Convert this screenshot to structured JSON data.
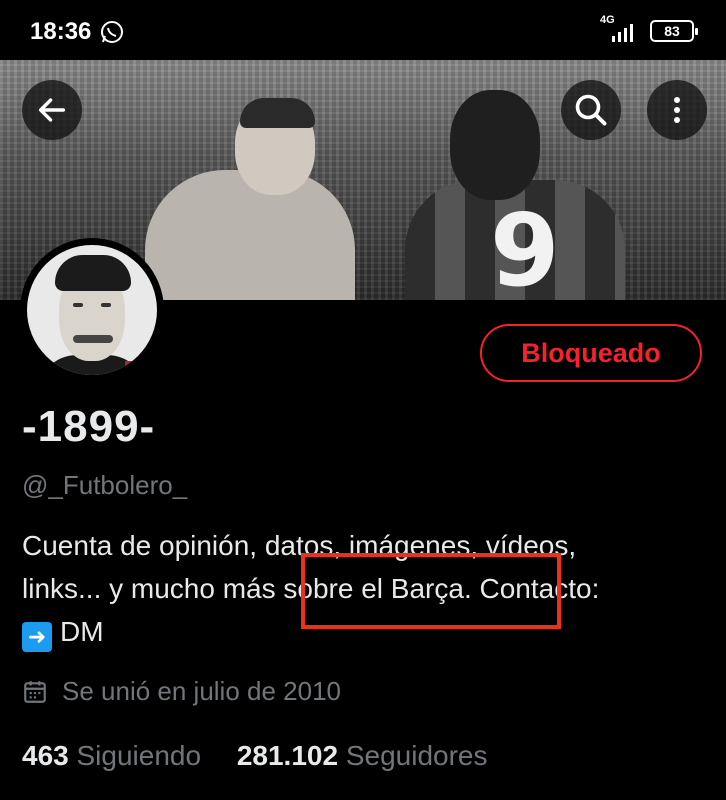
{
  "status_bar": {
    "time": "18:36",
    "network": "4G",
    "battery": "83"
  },
  "profile": {
    "display_name": "-1899-",
    "handle": "@_Futbolero_",
    "blocked_label": "Bloqueado",
    "bio_line1": "Cuenta de opinión, datos, imágenes, vídeos,",
    "bio_line2": "links... y mucho más sobre el Barça. Contacto:",
    "bio_line3": "DM",
    "bio_emoji": "➡️",
    "joined": "Se unió en julio de 2010",
    "following_count": "463",
    "following_label": "Siguiendo",
    "followers_count": "281.102",
    "followers_label": "Seguidores"
  },
  "banner": {
    "jersey_number": "9"
  },
  "icons": {
    "back": "arrow-left-icon",
    "search": "search-icon",
    "more": "more-vertical-icon",
    "calendar": "calendar-icon",
    "whatsapp": "whatsapp-icon"
  },
  "colors": {
    "blocked": "#f4212e",
    "annotation_box": "#e8321e",
    "secondary_text": "#71767b"
  }
}
